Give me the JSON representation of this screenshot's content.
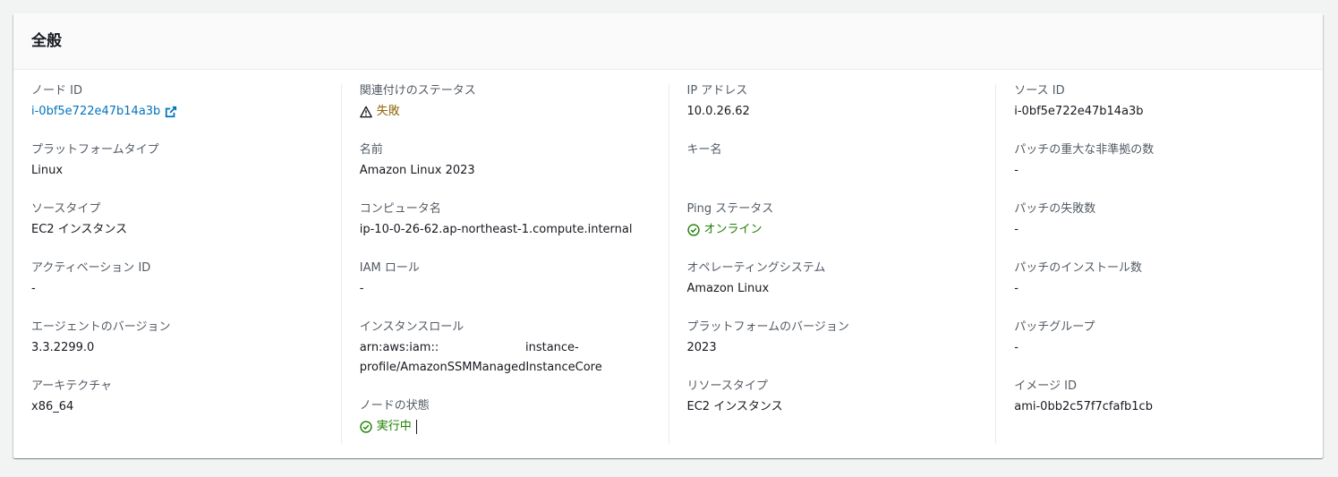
{
  "panel": {
    "title": "全般"
  },
  "columns": [
    {
      "fields": [
        {
          "label": "ノード ID",
          "value": "i-0bf5e722e47b14a3b"
        },
        {
          "label": "プラットフォームタイプ",
          "value": "Linux"
        },
        {
          "label": "ソースタイプ",
          "value": "EC2 インスタンス"
        },
        {
          "label": "アクティベーション ID",
          "value": "-"
        },
        {
          "label": "エージェントのバージョン",
          "value": "3.3.2299.0"
        },
        {
          "label": "アーキテクチャ",
          "value": "x86_64"
        }
      ]
    },
    {
      "fields": [
        {
          "label": "関連付けのステータス",
          "value": "失敗"
        },
        {
          "label": "名前",
          "value": "Amazon Linux 2023"
        },
        {
          "label": "コンピュータ名",
          "value": "ip-10-0-26-62.ap-northeast-1.compute.internal"
        },
        {
          "label": "IAM ロール",
          "value": "-"
        },
        {
          "label": "インスタンスロール",
          "value_line1": "arn:aws:iam::",
          "value_line1b": "instance-",
          "value_line2": "profile/AmazonSSMManagedInstanceCore"
        },
        {
          "label": "ノードの状態",
          "value": "実行中"
        }
      ]
    },
    {
      "fields": [
        {
          "label": "IP アドレス",
          "value": "10.0.26.62"
        },
        {
          "label": "キー名",
          "value": ""
        },
        {
          "label": "Ping ステータス",
          "value": "オンライン"
        },
        {
          "label": "オペレーティングシステム",
          "value": "Amazon Linux"
        },
        {
          "label": "プラットフォームのバージョン",
          "value": "2023"
        },
        {
          "label": "リソースタイプ",
          "value": "EC2 インスタンス"
        }
      ]
    },
    {
      "fields": [
        {
          "label": "ソース ID",
          "value": "i-0bf5e722e47b14a3b"
        },
        {
          "label": "パッチの重大な非準拠の数",
          "value": "-"
        },
        {
          "label": "パッチの失敗数",
          "value": "-"
        },
        {
          "label": "パッチのインストール数",
          "value": "-"
        },
        {
          "label": "パッチグループ",
          "value": "-"
        },
        {
          "label": "イメージ ID",
          "value": "ami-0bb2c57f7cfafb1cb"
        }
      ]
    }
  ],
  "colors": {
    "link": "#0073bb",
    "warning": "#8d6605",
    "success": "#1d8102",
    "label": "#545b64"
  },
  "icons": {
    "node_id_link": "external-link-icon",
    "association_status": "warning-icon",
    "node_state": "status-ok-icon",
    "ping_status": "status-ok-icon"
  }
}
